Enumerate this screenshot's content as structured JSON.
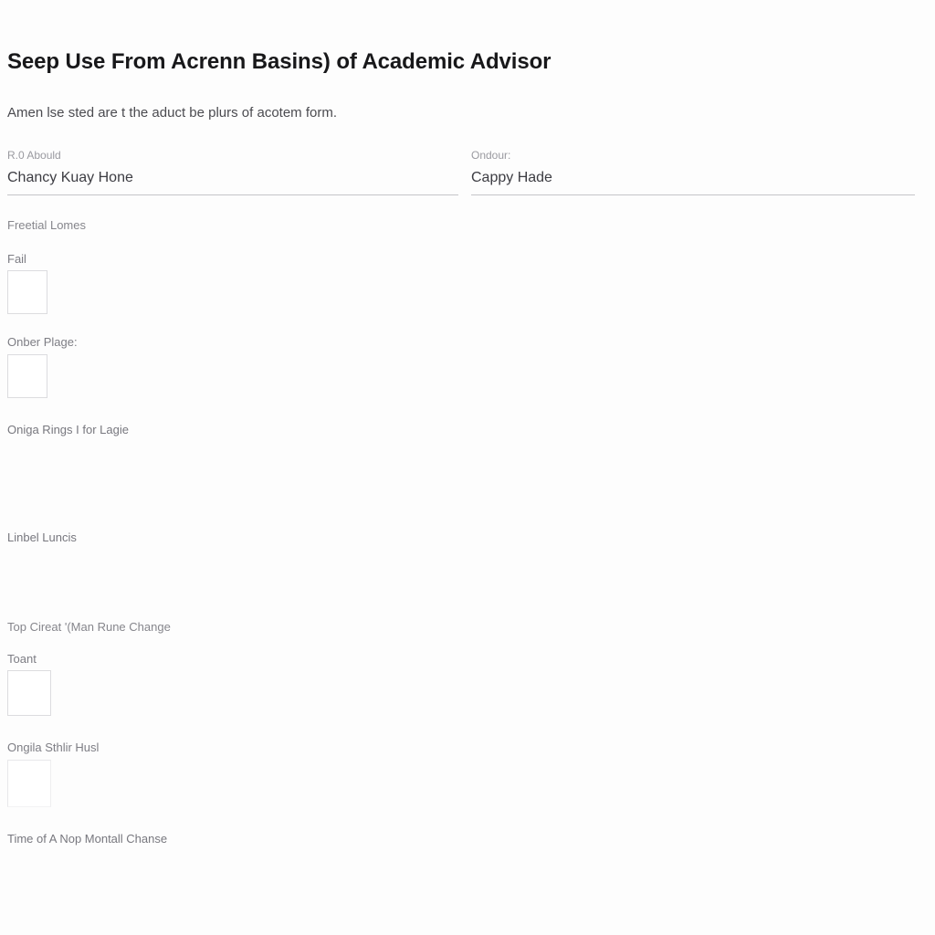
{
  "document": {
    "title": "Seep Use From Acrenn Basins) of Academic Advisor",
    "subtitle": "Amen lse sted are t the aduct be plurs of acotem form."
  },
  "fields": [
    {
      "label": "R.0 Abould",
      "value": "Chancy Kuay Hone",
      "placeholder": "R.0 Abould"
    },
    {
      "label": "Ondour:",
      "value": "Cappy Hade",
      "placeholder": "Ondour:"
    }
  ],
  "sections": [
    {
      "heading": "Freetial Lomes",
      "groups": [
        {
          "label": "Fail"
        },
        {
          "label": "Onber Plage:"
        }
      ],
      "note": "Oniga Rings I for Lagie",
      "note2": "Linbel Luncis"
    },
    {
      "heading": "Top Cireat '(Man Rune Change",
      "groups": [
        {
          "label": "Toant"
        },
        {
          "label": "Ongila Sthlir Husl"
        }
      ],
      "note": "Time of A Nop Montall Chanse"
    }
  ],
  "colors": {
    "background": "#fdfdfd",
    "title_text": "#18181a",
    "body_text": "#4b4b50",
    "label_text": "#9a9aa0",
    "value_text": "#3c3c42",
    "underline": "#c4c4c8",
    "box_border": "#dcdcdf",
    "box_fill": "#ffffff"
  }
}
